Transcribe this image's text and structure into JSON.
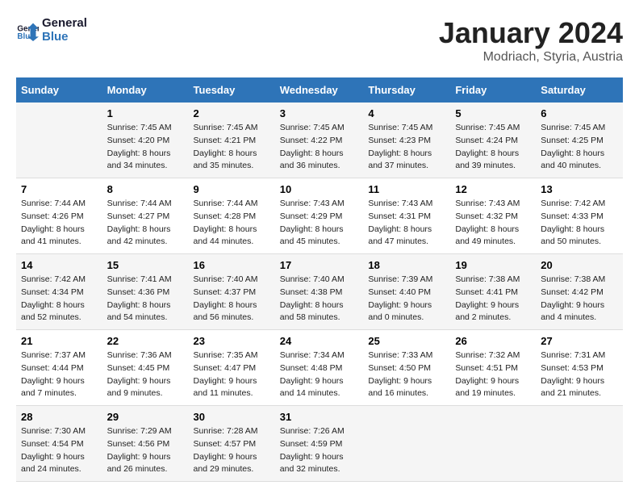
{
  "header": {
    "logo_line1": "General",
    "logo_line2": "Blue",
    "month": "January 2024",
    "location": "Modriach, Styria, Austria"
  },
  "weekdays": [
    "Sunday",
    "Monday",
    "Tuesday",
    "Wednesday",
    "Thursday",
    "Friday",
    "Saturday"
  ],
  "weeks": [
    [
      {
        "day": "",
        "info": ""
      },
      {
        "day": "1",
        "info": "Sunrise: 7:45 AM\nSunset: 4:20 PM\nDaylight: 8 hours\nand 34 minutes."
      },
      {
        "day": "2",
        "info": "Sunrise: 7:45 AM\nSunset: 4:21 PM\nDaylight: 8 hours\nand 35 minutes."
      },
      {
        "day": "3",
        "info": "Sunrise: 7:45 AM\nSunset: 4:22 PM\nDaylight: 8 hours\nand 36 minutes."
      },
      {
        "day": "4",
        "info": "Sunrise: 7:45 AM\nSunset: 4:23 PM\nDaylight: 8 hours\nand 37 minutes."
      },
      {
        "day": "5",
        "info": "Sunrise: 7:45 AM\nSunset: 4:24 PM\nDaylight: 8 hours\nand 39 minutes."
      },
      {
        "day": "6",
        "info": "Sunrise: 7:45 AM\nSunset: 4:25 PM\nDaylight: 8 hours\nand 40 minutes."
      }
    ],
    [
      {
        "day": "7",
        "info": "Sunrise: 7:44 AM\nSunset: 4:26 PM\nDaylight: 8 hours\nand 41 minutes."
      },
      {
        "day": "8",
        "info": "Sunrise: 7:44 AM\nSunset: 4:27 PM\nDaylight: 8 hours\nand 42 minutes."
      },
      {
        "day": "9",
        "info": "Sunrise: 7:44 AM\nSunset: 4:28 PM\nDaylight: 8 hours\nand 44 minutes."
      },
      {
        "day": "10",
        "info": "Sunrise: 7:43 AM\nSunset: 4:29 PM\nDaylight: 8 hours\nand 45 minutes."
      },
      {
        "day": "11",
        "info": "Sunrise: 7:43 AM\nSunset: 4:31 PM\nDaylight: 8 hours\nand 47 minutes."
      },
      {
        "day": "12",
        "info": "Sunrise: 7:43 AM\nSunset: 4:32 PM\nDaylight: 8 hours\nand 49 minutes."
      },
      {
        "day": "13",
        "info": "Sunrise: 7:42 AM\nSunset: 4:33 PM\nDaylight: 8 hours\nand 50 minutes."
      }
    ],
    [
      {
        "day": "14",
        "info": "Sunrise: 7:42 AM\nSunset: 4:34 PM\nDaylight: 8 hours\nand 52 minutes."
      },
      {
        "day": "15",
        "info": "Sunrise: 7:41 AM\nSunset: 4:36 PM\nDaylight: 8 hours\nand 54 minutes."
      },
      {
        "day": "16",
        "info": "Sunrise: 7:40 AM\nSunset: 4:37 PM\nDaylight: 8 hours\nand 56 minutes."
      },
      {
        "day": "17",
        "info": "Sunrise: 7:40 AM\nSunset: 4:38 PM\nDaylight: 8 hours\nand 58 minutes."
      },
      {
        "day": "18",
        "info": "Sunrise: 7:39 AM\nSunset: 4:40 PM\nDaylight: 9 hours\nand 0 minutes."
      },
      {
        "day": "19",
        "info": "Sunrise: 7:38 AM\nSunset: 4:41 PM\nDaylight: 9 hours\nand 2 minutes."
      },
      {
        "day": "20",
        "info": "Sunrise: 7:38 AM\nSunset: 4:42 PM\nDaylight: 9 hours\nand 4 minutes."
      }
    ],
    [
      {
        "day": "21",
        "info": "Sunrise: 7:37 AM\nSunset: 4:44 PM\nDaylight: 9 hours\nand 7 minutes."
      },
      {
        "day": "22",
        "info": "Sunrise: 7:36 AM\nSunset: 4:45 PM\nDaylight: 9 hours\nand 9 minutes."
      },
      {
        "day": "23",
        "info": "Sunrise: 7:35 AM\nSunset: 4:47 PM\nDaylight: 9 hours\nand 11 minutes."
      },
      {
        "day": "24",
        "info": "Sunrise: 7:34 AM\nSunset: 4:48 PM\nDaylight: 9 hours\nand 14 minutes."
      },
      {
        "day": "25",
        "info": "Sunrise: 7:33 AM\nSunset: 4:50 PM\nDaylight: 9 hours\nand 16 minutes."
      },
      {
        "day": "26",
        "info": "Sunrise: 7:32 AM\nSunset: 4:51 PM\nDaylight: 9 hours\nand 19 minutes."
      },
      {
        "day": "27",
        "info": "Sunrise: 7:31 AM\nSunset: 4:53 PM\nDaylight: 9 hours\nand 21 minutes."
      }
    ],
    [
      {
        "day": "28",
        "info": "Sunrise: 7:30 AM\nSunset: 4:54 PM\nDaylight: 9 hours\nand 24 minutes."
      },
      {
        "day": "29",
        "info": "Sunrise: 7:29 AM\nSunset: 4:56 PM\nDaylight: 9 hours\nand 26 minutes."
      },
      {
        "day": "30",
        "info": "Sunrise: 7:28 AM\nSunset: 4:57 PM\nDaylight: 9 hours\nand 29 minutes."
      },
      {
        "day": "31",
        "info": "Sunrise: 7:26 AM\nSunset: 4:59 PM\nDaylight: 9 hours\nand 32 minutes."
      },
      {
        "day": "",
        "info": ""
      },
      {
        "day": "",
        "info": ""
      },
      {
        "day": "",
        "info": ""
      }
    ]
  ]
}
